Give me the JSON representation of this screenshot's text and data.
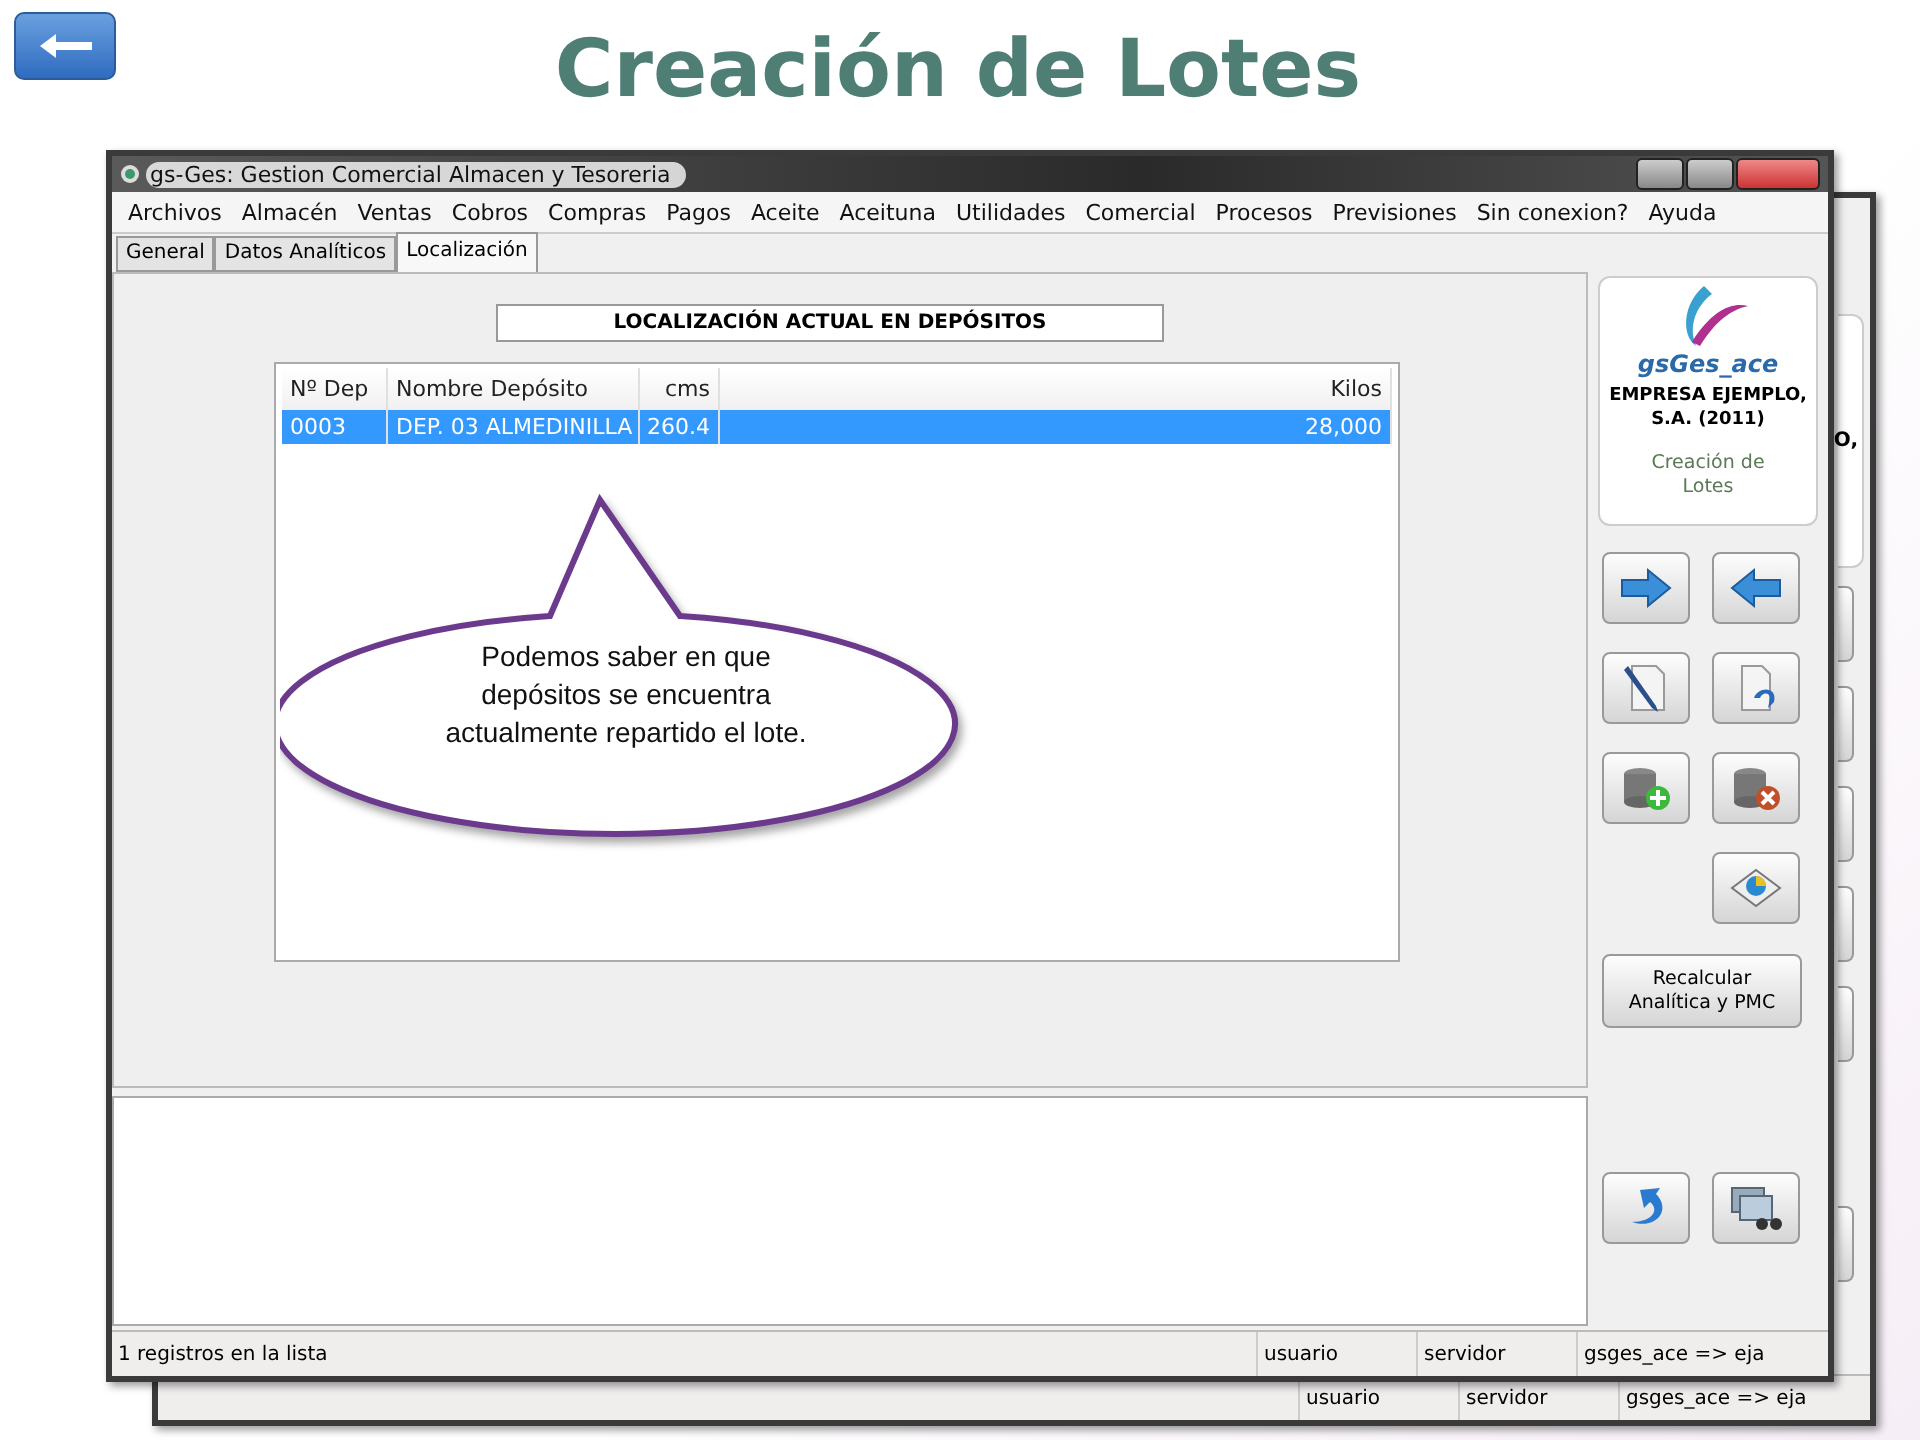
{
  "slide_title": "Creación de Lotes",
  "window": {
    "title": "gs-Ges: Gestion Comercial Almacen y Tesoreria"
  },
  "menu": [
    "Archivos",
    "Almacén",
    "Ventas",
    "Cobros",
    "Compras",
    "Pagos",
    "Aceite",
    "Aceituna",
    "Utilidades",
    "Comercial",
    "Procesos",
    "Previsiones",
    "Sin conexion?",
    "Ayuda"
  ],
  "tabs": [
    {
      "label": "General",
      "selected": false
    },
    {
      "label": "Datos Analíticos",
      "selected": false
    },
    {
      "label": "Localización",
      "selected": true
    }
  ],
  "section_title": "LOCALIZACIÓN ACTUAL EN DEPÓSITOS",
  "table": {
    "columns": [
      "Nº Dep",
      "Nombre Depósito",
      "cms",
      "Kilos"
    ],
    "rows": [
      {
        "cells": [
          "0003",
          "DEP. 03 ALMEDINILLA",
          "260.4",
          "28,000"
        ],
        "selected": true
      }
    ]
  },
  "callout": "Podemos saber en  que depósitos se encuentra actualmente repartido el lote.",
  "company_card": {
    "app_name": "gsGes_ace",
    "company": "EMPRESA EJEMPLO, S.A. (2011)",
    "module": "Creación de Lotes"
  },
  "recalc_button": "Recalcular Analítica y PMC",
  "status_bar": [
    "1 registros en la lista",
    "usuario",
    "servidor",
    "gsges_ace => eja"
  ],
  "back_window": {
    "card_fragment": "O,",
    "status_bar": [
      "usuario",
      "servidor",
      "gsges_ace => eja"
    ]
  }
}
